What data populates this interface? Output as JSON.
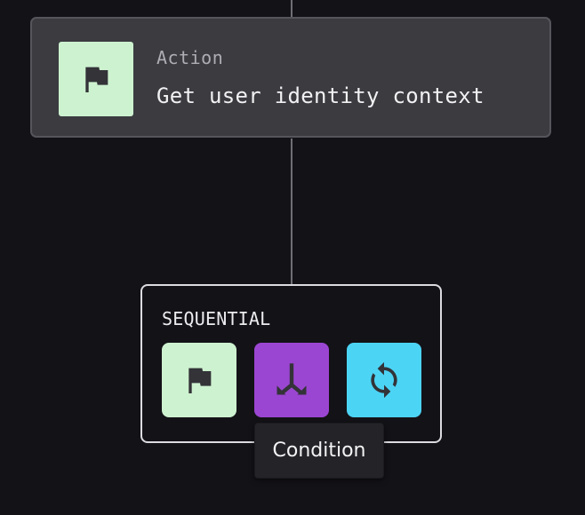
{
  "action_node": {
    "kind_label": "Action",
    "title": "Get user identity context",
    "icon": "flag-icon",
    "icon_bg": "#cdf2cf"
  },
  "sequential_panel": {
    "label": "SEQUENTIAL",
    "buttons": [
      {
        "icon": "flag-icon",
        "bg": "#cdf2cf"
      },
      {
        "icon": "merge-arrows-icon",
        "bg": "#9b46d2"
      },
      {
        "icon": "refresh-cycle-icon",
        "bg": "#4cd4f5"
      }
    ]
  },
  "tooltip": {
    "text": "Condition"
  },
  "colors": {
    "background": "#131217",
    "card": "#3b3b40",
    "connector": "#6f6e75",
    "icon_glyph": "#333338"
  }
}
